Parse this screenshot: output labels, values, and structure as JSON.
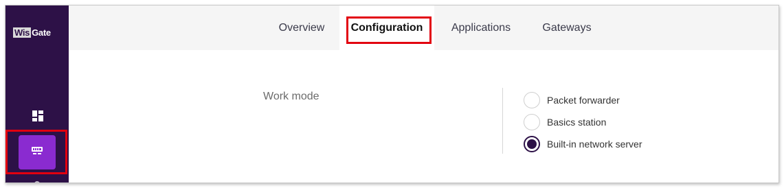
{
  "app": {
    "logo_part1": "Wis",
    "logo_part2": "Gate"
  },
  "sidebar": {
    "items": [
      {
        "icon": "dashboard-icon",
        "active": false
      },
      {
        "icon": "gateway-device-icon",
        "active": true
      }
    ]
  },
  "tabs": [
    {
      "label": "Overview",
      "active": false
    },
    {
      "label": "Configuration",
      "active": true
    },
    {
      "label": "Applications",
      "active": false
    },
    {
      "label": "Gateways",
      "active": false
    }
  ],
  "work_mode": {
    "label": "Work mode",
    "options": [
      {
        "label": "Packet forwarder",
        "selected": false
      },
      {
        "label": "Basics station",
        "selected": false
      },
      {
        "label": "Built-in network server",
        "selected": true
      }
    ]
  },
  "colors": {
    "sidebar_bg": "#2d1147",
    "active_nav": "#8a2bd0",
    "highlight": "#e2000f",
    "topnav_bg": "#f5f5f5"
  }
}
